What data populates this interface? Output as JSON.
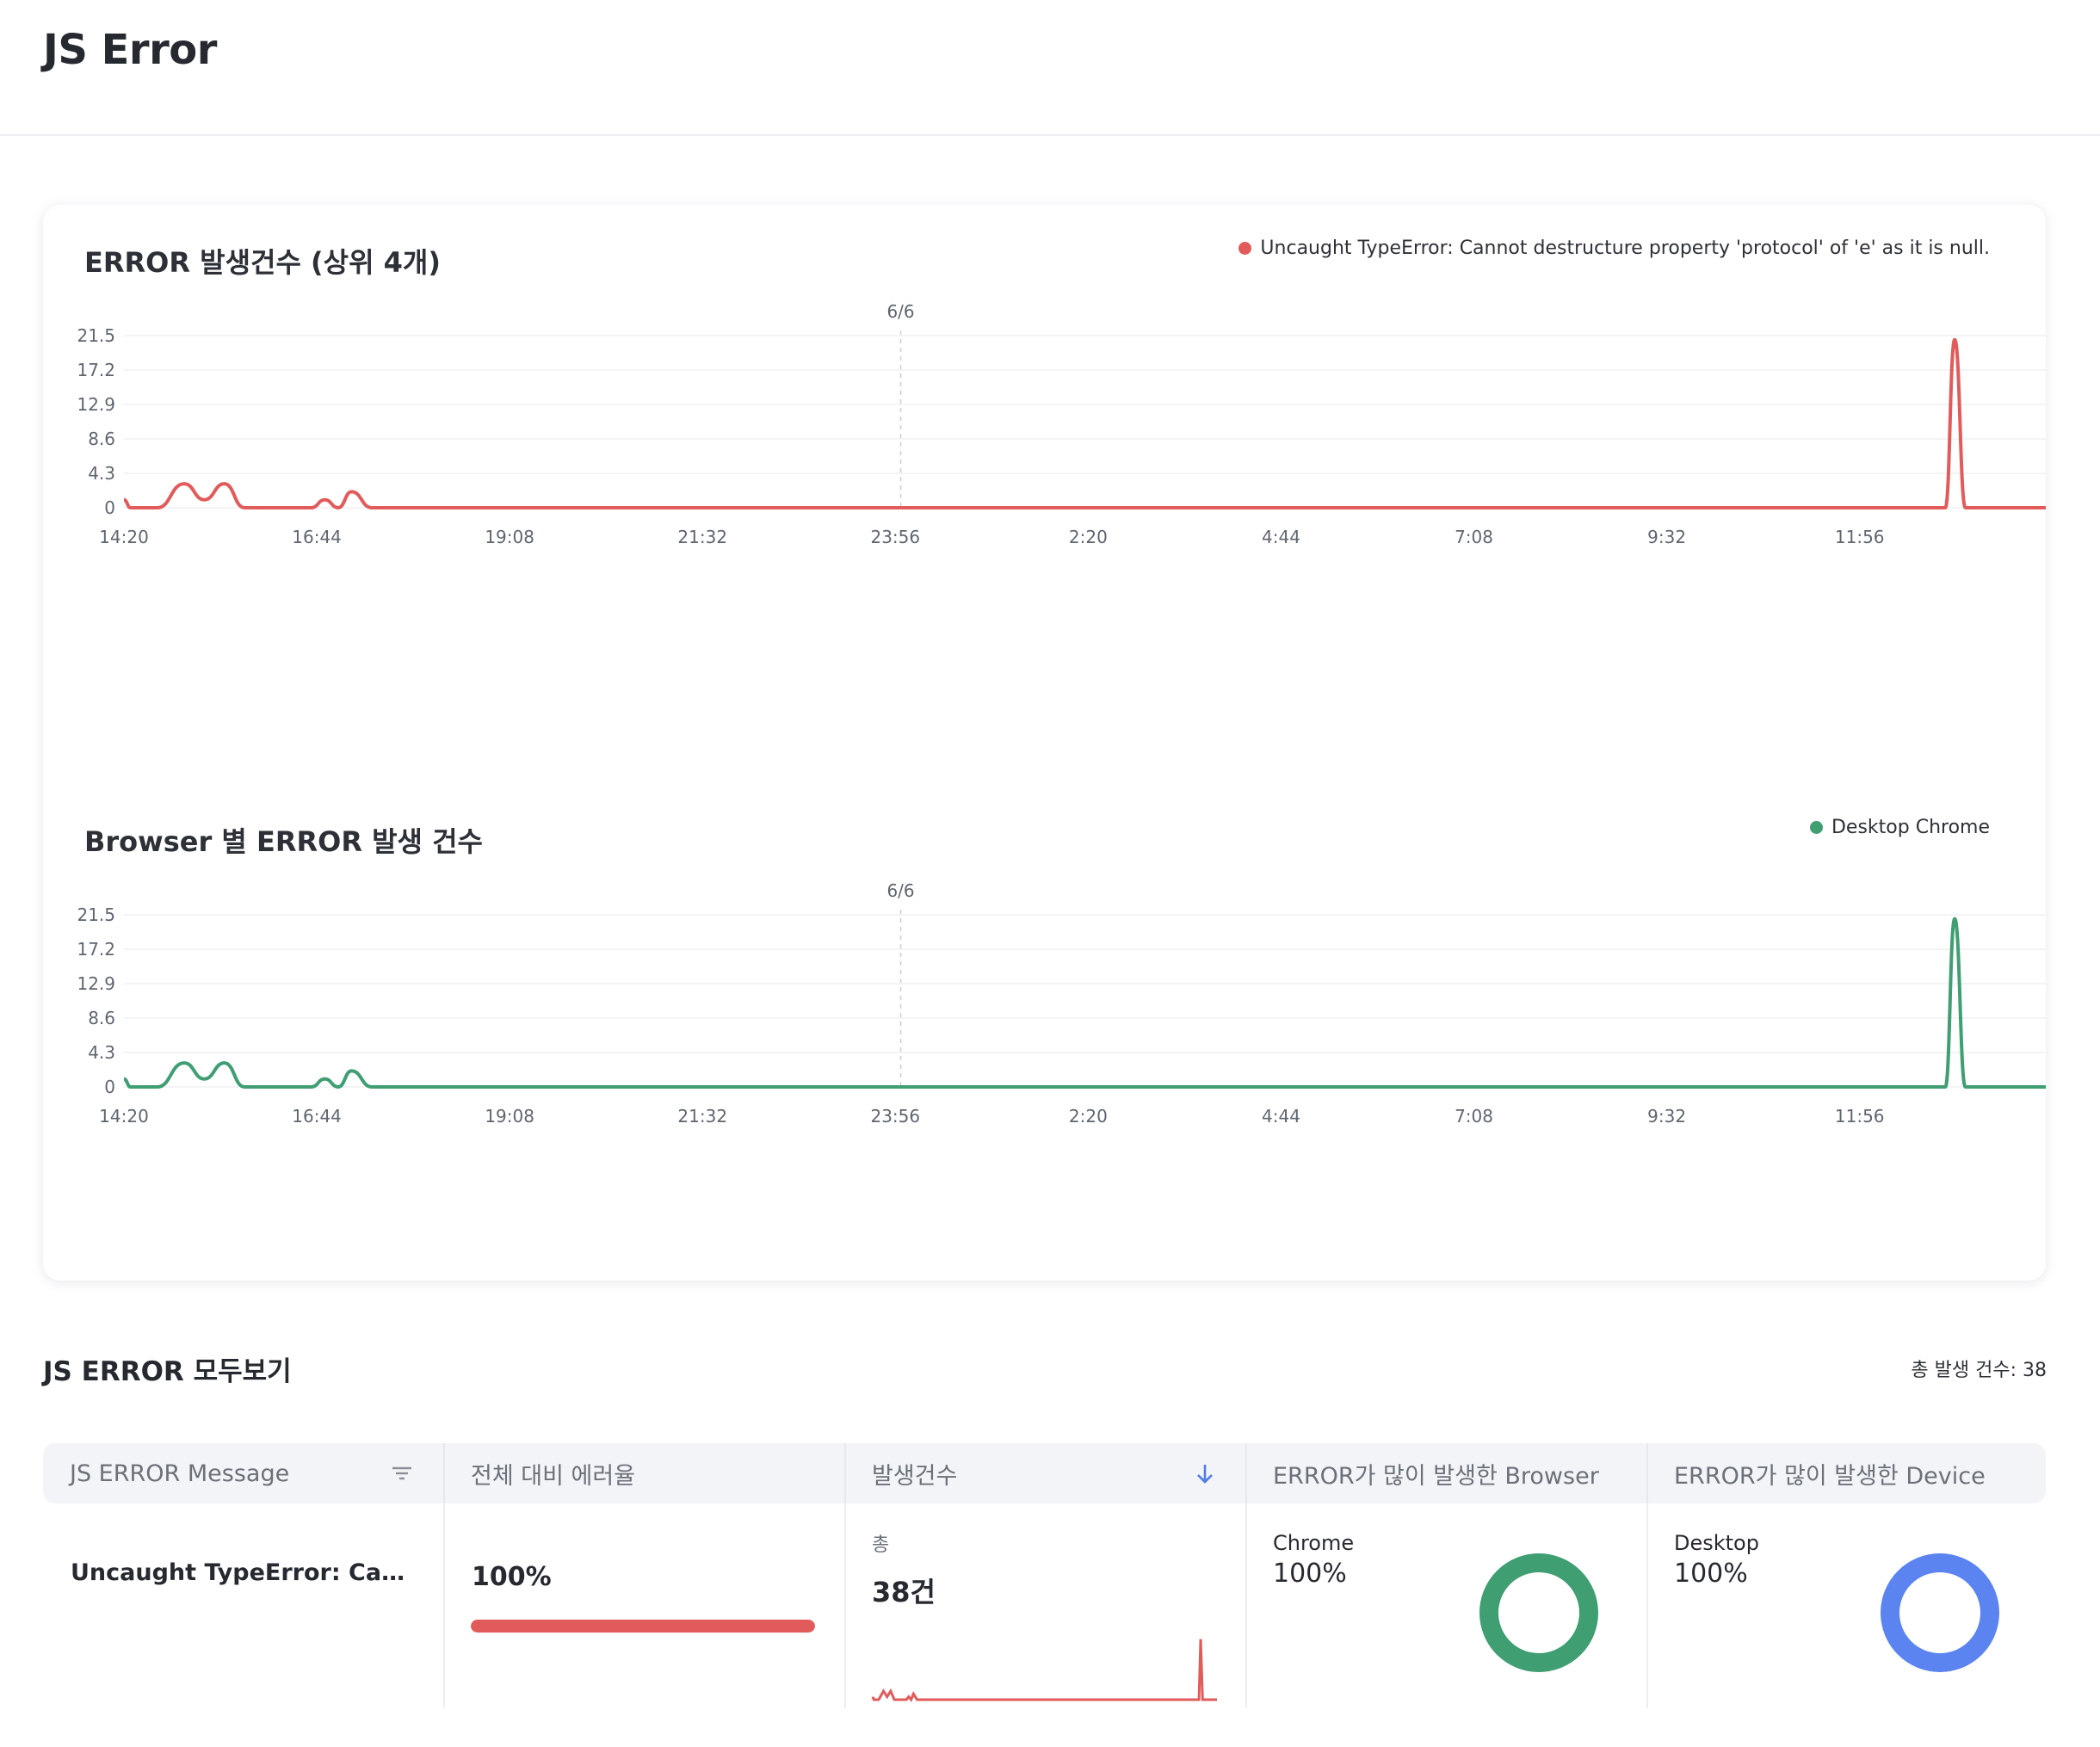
{
  "page": {
    "title": "JS Error"
  },
  "charts": [
    {
      "title": "ERROR 발생건수 (상위 4개)",
      "legend": "Uncaught TypeError: Cannot destructure property 'protocol' of 'e' as it is null.",
      "color": "#e25b5b"
    },
    {
      "title": "Browser 별 ERROR 발생 건수",
      "legend": "Desktop Chrome",
      "color": "#3f9e72"
    }
  ],
  "chart_data": [
    {
      "type": "line",
      "title": "ERROR 발생건수 (상위 4개)",
      "y_ticks": [
        "21.5",
        "17.2",
        "12.9",
        "8.6",
        "4.3",
        "0"
      ],
      "ylim": [
        0,
        21.5
      ],
      "x_ticks": [
        "14:20",
        "16:44",
        "19:08",
        "21:32",
        "23:56",
        "2:20",
        "4:44",
        "7:08",
        "9:32",
        "11:56"
      ],
      "date_marker": "6/6",
      "series": [
        {
          "name": "Uncaught TypeError: Cannot destructure property 'protocol' of 'e' as it is null.",
          "color": "#e25b5b",
          "points": [
            [
              0,
              1
            ],
            [
              5,
              0
            ],
            [
              25,
              0
            ],
            [
              45,
              3
            ],
            [
              60,
              1
            ],
            [
              75,
              3
            ],
            [
              90,
              0
            ],
            [
              140,
              0
            ],
            [
              150,
              1
            ],
            [
              160,
              0
            ],
            [
              170,
              2
            ],
            [
              185,
              0
            ],
            [
              1360,
              0
            ],
            [
              1367,
              21
            ],
            [
              1375,
              0
            ],
            [
              1435,
              0
            ]
          ]
        }
      ]
    },
    {
      "type": "line",
      "title": "Browser 별 ERROR 발생 건수",
      "y_ticks": [
        "21.5",
        "17.2",
        "12.9",
        "8.6",
        "4.3",
        "0"
      ],
      "ylim": [
        0,
        21.5
      ],
      "x_ticks": [
        "14:20",
        "16:44",
        "19:08",
        "21:32",
        "23:56",
        "2:20",
        "4:44",
        "7:08",
        "9:32",
        "11:56"
      ],
      "date_marker": "6/6",
      "series": [
        {
          "name": "Desktop Chrome",
          "color": "#3f9e72",
          "points": [
            [
              0,
              1
            ],
            [
              5,
              0
            ],
            [
              25,
              0
            ],
            [
              45,
              3
            ],
            [
              60,
              1
            ],
            [
              75,
              3
            ],
            [
              90,
              0
            ],
            [
              140,
              0
            ],
            [
              150,
              1
            ],
            [
              160,
              0
            ],
            [
              170,
              2
            ],
            [
              185,
              0
            ],
            [
              1360,
              0
            ],
            [
              1367,
              21
            ],
            [
              1375,
              0
            ],
            [
              1435,
              0
            ]
          ]
        }
      ]
    }
  ],
  "section": {
    "title": "JS ERROR 모두보기",
    "total_label": "총 발생 건수: 38"
  },
  "table": {
    "headers": [
      "JS ERROR Message",
      "전체 대비 에러율",
      "발생건수",
      "ERROR가 많이 발생한 Browser",
      "ERROR가 많이 발생한 Device"
    ],
    "header_icons": {
      "message": "filter-icon",
      "count": "sort-arrow-down-icon"
    },
    "rows": [
      {
        "message": "Uncaught TypeError: Cannot destructure property 'protocol' of 'e' as it is null.",
        "rate": "100%",
        "rate_fraction": 1.0,
        "count_prefix": "총",
        "count": "38건",
        "browser_name": "Chrome",
        "browser_pct": "100%",
        "browser_color": "#3f9e72",
        "device_name": "Desktop",
        "device_pct": "100%",
        "device_color": "#5b84f1"
      }
    ]
  }
}
